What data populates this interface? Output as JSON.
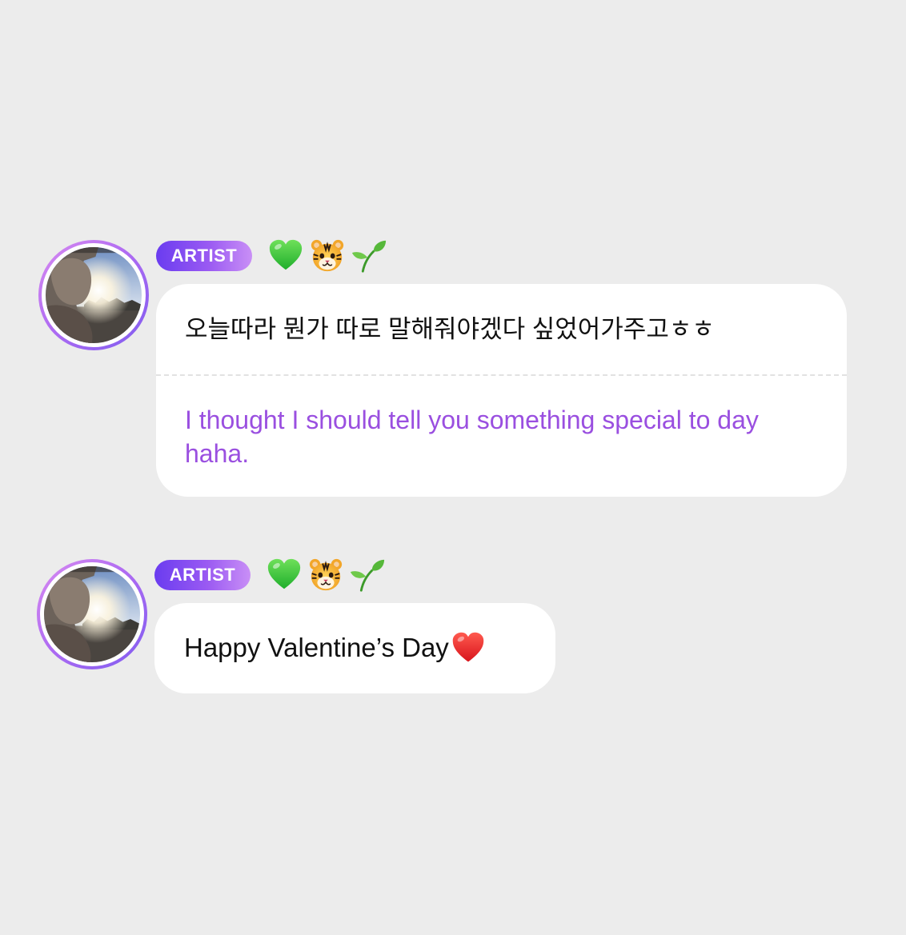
{
  "messages": [
    {
      "badge": "ARTIST",
      "emojis": [
        "green-heart-emoji",
        "tiger-face-emoji",
        "seedling-emoji"
      ],
      "text": "오늘따라 뭔가 따로 말해줘야겠다 싶었어가주고ㅎㅎ",
      "translation": "I thought I should tell you something special to day haha."
    },
    {
      "badge": "ARTIST",
      "emojis": [
        "green-heart-emoji",
        "tiger-face-emoji",
        "seedling-emoji"
      ],
      "text": "Happy Valentine’s Day",
      "trailing_emoji": "red-heart-emoji"
    }
  ],
  "colors": {
    "background": "#ececec",
    "bubble": "#ffffff",
    "translation_text": "#9a4fe0",
    "badge_gradient_start": "#6a3cf0",
    "badge_gradient_end": "#c98ff6"
  }
}
